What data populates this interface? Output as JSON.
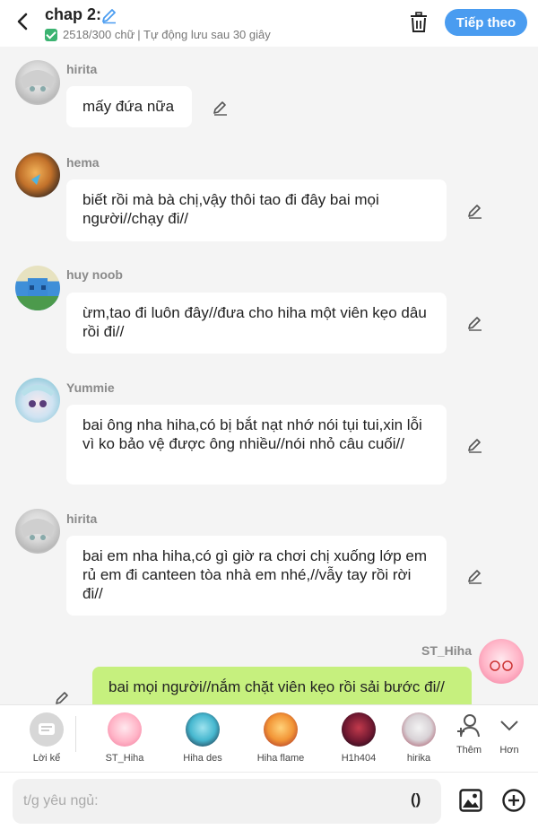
{
  "header": {
    "title": "chap 2:",
    "word_count": "2518/300 chữ",
    "autosave": "| Tự động lưu sau 30 giây",
    "next_label": "Tiếp theo"
  },
  "messages": [
    {
      "name": "hirita",
      "text": "mấy đứa nữa"
    },
    {
      "name": "hema",
      "text": "biết rồi mà bà chị,vậy thôi tao đi đây bai mọi người//chạy đi//"
    },
    {
      "name": "huy noob",
      "text": "ừm,tao đi luôn đây//đưa cho hiha một viên kẹo dâu rồi đi//"
    },
    {
      "name": "Yummie",
      "text": "bai ông nha hiha,có bị bắt nạt nhớ nói tụi tui,xin lỗi vì ko bảo vệ được ông nhiều//nói nhỏ câu cuối//"
    },
    {
      "name": "hirita",
      "text": "bai em nha hiha,có gì giờ ra chơi chị xuống lớp em rủ em đi canteen tòa nhà em nhé,//vẫy tay rồi rời đi//"
    },
    {
      "name": "ST_Hiha",
      "text": "bai mọi người//nắm chặt viên kẹo rồi sải bước đi//"
    }
  ],
  "characters": [
    {
      "name": "Lời kể"
    },
    {
      "name": "ST_Hiha"
    },
    {
      "name": "Hiha des"
    },
    {
      "name": "Hiha flame"
    },
    {
      "name": "H1h404"
    },
    {
      "name": "hirika"
    }
  ],
  "more": {
    "add_label": "Thêm",
    "more_label": "Hơn"
  },
  "input": {
    "placeholder": "t/g yêu ngủ:",
    "paren_label": "()"
  },
  "colors": {
    "accent": "#4a9cf0",
    "my_bubble": "#c6f07e",
    "check": "#3cb371"
  }
}
